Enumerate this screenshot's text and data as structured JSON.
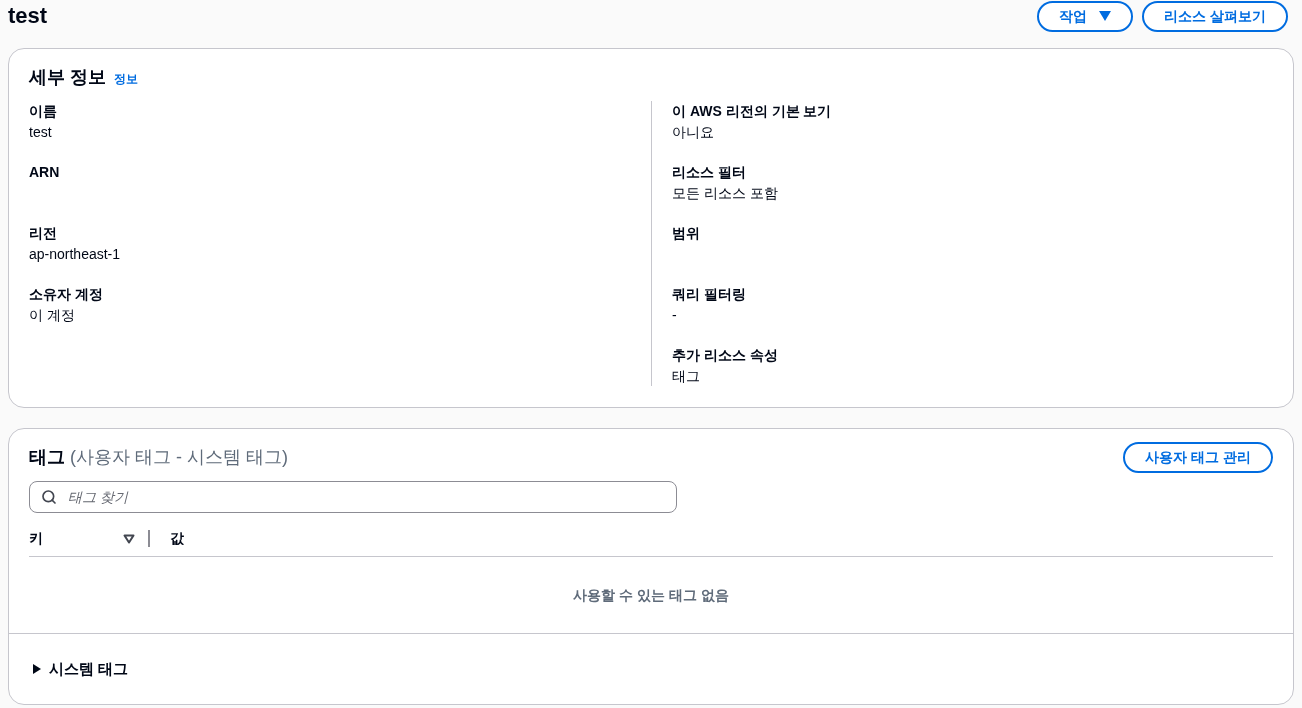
{
  "page": {
    "title": "test",
    "actions": [
      {
        "kind": "dropdown",
        "label": "작업"
      },
      {
        "kind": "button",
        "label": "리소스 살펴보기"
      }
    ]
  },
  "details": {
    "title": "세부 정보",
    "info_link": "정보",
    "columns": [
      [
        {
          "label": "이름",
          "value": "test"
        },
        {
          "label": "ARN"
        },
        {
          "label": "리전",
          "value": "ap-northeast-1"
        },
        {
          "label": "소유자 계정",
          "value": "이 계정"
        }
      ],
      [
        {
          "label": "이 AWS 리전의 기본 보기",
          "value": "아니요"
        },
        {
          "label": "리소스 필터",
          "value": "모든 리소스 포함"
        },
        {
          "label": "범위"
        },
        {
          "label": "쿼리 필터링",
          "value": "-"
        },
        {
          "label": "추가 리소스 속성",
          "value": "태그"
        }
      ]
    ]
  },
  "tags": {
    "title": "태그",
    "subtitle": "(사용자 태그 - 시스템 태그)",
    "manage_button": "사용자 태그 관리",
    "search": {
      "placeholder": "태그 찾기"
    },
    "table": {
      "columns": [
        {
          "label": "키",
          "sortable": true
        },
        {
          "label": "값",
          "sortable": false
        }
      ],
      "empty_message": "사용할 수 있는 태그 없음"
    },
    "system_tags": {
      "label": "시스템 태그",
      "expanded": false
    }
  }
}
